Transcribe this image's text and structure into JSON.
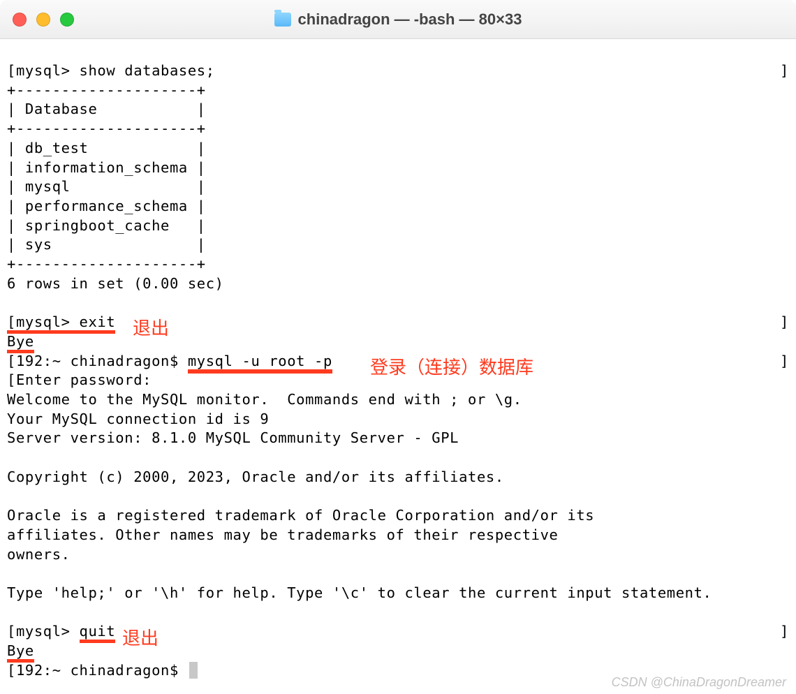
{
  "window": {
    "title": "chinadragon — -bash — 80×33"
  },
  "terminal": {
    "line01": "[mysql> show databases;",
    "line02": "+--------------------+",
    "line03": "| Database           |",
    "line04": "+--------------------+",
    "line05": "| db_test            |",
    "line06": "| information_schema |",
    "line07": "| mysql              |",
    "line08": "| performance_schema |",
    "line09": "| springboot_cache   |",
    "line10": "| sys                |",
    "line11": "+--------------------+",
    "line12": "6 rows in set (0.00 sec)",
    "line13_prefix": "[mysql> ",
    "line13_cmd": "exit",
    "line14": "Bye",
    "line15_prefix": "[192:~ chinadragon$ ",
    "line15_cmd": "mysql -u root -p",
    "line16": "[Enter password:",
    "line17": "Welcome to the MySQL monitor.  Commands end with ; or \\g.",
    "line18": "Your MySQL connection id is 9",
    "line19": "Server version: 8.1.0 MySQL Community Server - GPL",
    "line20": "Copyright (c) 2000, 2023, Oracle and/or its affiliates.",
    "line21": "Oracle is a registered trademark of Oracle Corporation and/or its",
    "line22": "affiliates. Other names may be trademarks of their respective",
    "line23": "owners.",
    "line24": "Type 'help;' or '\\h' for help. Type '\\c' to clear the current input statement.",
    "line25_prefix": "[mysql> ",
    "line25_cmd": "quit",
    "line26": "Bye",
    "line27": "[192:~ chinadragon$ "
  },
  "annotations": {
    "exit_label": "退出",
    "login_label": "登录（连接）数据库",
    "quit_label": "退出"
  },
  "watermark": "CSDN @ChinaDragonDreamer",
  "bracket_r": "]"
}
